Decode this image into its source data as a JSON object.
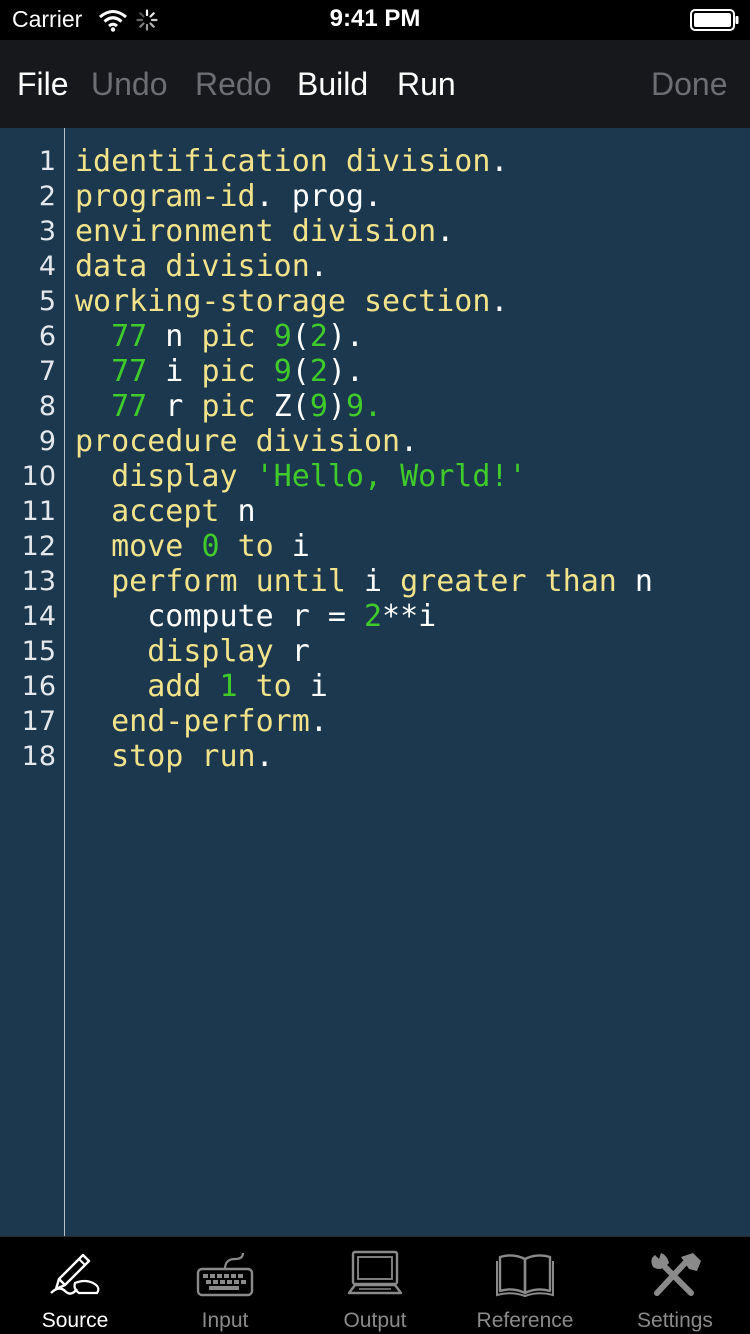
{
  "status_bar": {
    "carrier": "Carrier",
    "time": "9:41 PM"
  },
  "toolbar": {
    "file": "File",
    "undo": "Undo",
    "redo": "Redo",
    "build": "Build",
    "run": "Run",
    "done": "Done"
  },
  "editor": {
    "line_numbers": [
      "1",
      "2",
      "3",
      "4",
      "5",
      "6",
      "7",
      "8",
      "9",
      "10",
      "11",
      "12",
      "13",
      "14",
      "15",
      "16",
      "17",
      "18"
    ],
    "lines": [
      [
        [
          "kw",
          "identification division"
        ],
        [
          "id",
          "."
        ]
      ],
      [
        [
          "kw",
          "program-id"
        ],
        [
          "id",
          ". prog."
        ]
      ],
      [
        [
          "kw",
          "environment division"
        ],
        [
          "id",
          "."
        ]
      ],
      [
        [
          "kw",
          "data division"
        ],
        [
          "id",
          "."
        ]
      ],
      [
        [
          "kw",
          "working-storage section"
        ],
        [
          "id",
          "."
        ]
      ],
      [
        [
          "id",
          "  "
        ],
        [
          "num",
          "77"
        ],
        [
          "id",
          " n "
        ],
        [
          "kw",
          "pic"
        ],
        [
          "id",
          " "
        ],
        [
          "num",
          "9"
        ],
        [
          "id",
          "("
        ],
        [
          "num",
          "2"
        ],
        [
          "id",
          ")."
        ]
      ],
      [
        [
          "id",
          "  "
        ],
        [
          "num",
          "77"
        ],
        [
          "id",
          " i "
        ],
        [
          "kw",
          "pic"
        ],
        [
          "id",
          " "
        ],
        [
          "num",
          "9"
        ],
        [
          "id",
          "("
        ],
        [
          "num",
          "2"
        ],
        [
          "id",
          ")."
        ]
      ],
      [
        [
          "id",
          "  "
        ],
        [
          "num",
          "77"
        ],
        [
          "id",
          " r "
        ],
        [
          "kw",
          "pic"
        ],
        [
          "id",
          " Z("
        ],
        [
          "num",
          "9"
        ],
        [
          "id",
          ")"
        ],
        [
          "num",
          "9."
        ]
      ],
      [
        [
          "kw",
          "procedure division"
        ],
        [
          "id",
          "."
        ]
      ],
      [
        [
          "id",
          "  "
        ],
        [
          "kw",
          "display"
        ],
        [
          "id",
          " "
        ],
        [
          "str",
          "'Hello, World!'"
        ]
      ],
      [
        [
          "id",
          "  "
        ],
        [
          "kw",
          "accept"
        ],
        [
          "id",
          " n"
        ]
      ],
      [
        [
          "id",
          "  "
        ],
        [
          "kw",
          "move"
        ],
        [
          "id",
          " "
        ],
        [
          "num",
          "0"
        ],
        [
          "id",
          " "
        ],
        [
          "kw",
          "to"
        ],
        [
          "id",
          " i"
        ]
      ],
      [
        [
          "id",
          "  "
        ],
        [
          "kw",
          "perform until"
        ],
        [
          "id",
          " i "
        ],
        [
          "kw",
          "greater than"
        ],
        [
          "id",
          " n"
        ]
      ],
      [
        [
          "id",
          "    compute r = "
        ],
        [
          "num",
          "2"
        ],
        [
          "id",
          "**i"
        ]
      ],
      [
        [
          "id",
          "    "
        ],
        [
          "kw",
          "display"
        ],
        [
          "id",
          " r"
        ]
      ],
      [
        [
          "id",
          "    "
        ],
        [
          "kw",
          "add"
        ],
        [
          "id",
          " "
        ],
        [
          "num",
          "1"
        ],
        [
          "id",
          " "
        ],
        [
          "kw",
          "to"
        ],
        [
          "id",
          " i"
        ]
      ],
      [
        [
          "id",
          "  "
        ],
        [
          "kw",
          "end-perform"
        ],
        [
          "id",
          "."
        ]
      ],
      [
        [
          "id",
          "  "
        ],
        [
          "kw",
          "stop run"
        ],
        [
          "id",
          "."
        ]
      ]
    ]
  },
  "tabbar": {
    "source": "Source",
    "input": "Input",
    "output": "Output",
    "reference": "Reference",
    "settings": "Settings"
  },
  "colors": {
    "editor_bg": "#1b384e",
    "keyword": "#f2e38a",
    "literal": "#3fcc2a",
    "identifier": "#ffffff",
    "toolbar_bg": "#17181c",
    "disabled": "#6c6e73"
  }
}
